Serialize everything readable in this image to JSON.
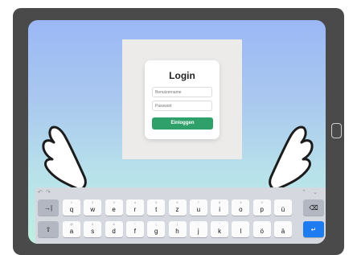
{
  "login": {
    "title": "Login",
    "username_placeholder": "Benutzername",
    "password_placeholder": "Passwort",
    "button_label": "Einloggen"
  },
  "keyboard": {
    "toolbar": {
      "undo": "↶",
      "redo": "↷",
      "up": "⌃",
      "down": "⌄"
    },
    "row1": [
      {
        "main": "q",
        "sub": "1"
      },
      {
        "main": "w",
        "sub": "2"
      },
      {
        "main": "e",
        "sub": "3"
      },
      {
        "main": "r",
        "sub": "4"
      },
      {
        "main": "t",
        "sub": "5"
      },
      {
        "main": "z",
        "sub": "6"
      },
      {
        "main": "u",
        "sub": "7"
      },
      {
        "main": "i",
        "sub": "8"
      },
      {
        "main": "o",
        "sub": "9"
      },
      {
        "main": "p",
        "sub": "0"
      },
      {
        "main": "ü",
        "sub": ""
      }
    ],
    "row2": [
      {
        "main": "a",
        "sub": "@"
      },
      {
        "main": "s",
        "sub": "#"
      },
      {
        "main": "d",
        "sub": "&"
      },
      {
        "main": "f",
        "sub": "*"
      },
      {
        "main": "g",
        "sub": "("
      },
      {
        "main": "h",
        "sub": ")"
      },
      {
        "main": "j",
        "sub": "'"
      },
      {
        "main": "k",
        "sub": "\""
      },
      {
        "main": "l",
        "sub": ""
      },
      {
        "main": "ö",
        "sub": ""
      },
      {
        "main": "ä",
        "sub": ""
      }
    ],
    "tab_label": "→|",
    "shift_label": "⇧",
    "backspace_label": "⌫",
    "enter_label": "↵"
  },
  "icons": {
    "wing_left": "wing-icon",
    "wing_right": "wing-icon",
    "home_button": "home-button"
  }
}
